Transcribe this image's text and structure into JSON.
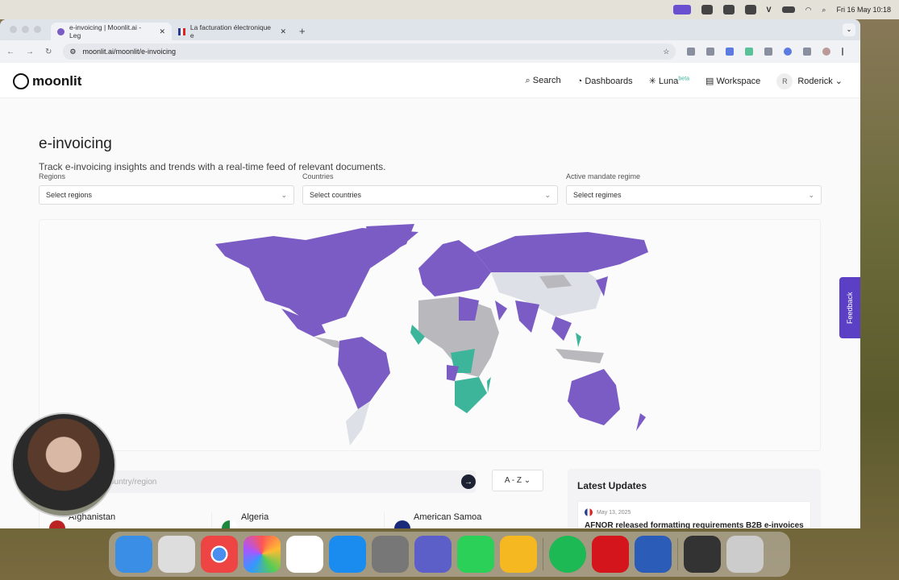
{
  "menubar": {
    "datetime": "Fri 16 May  10:18",
    "icons": [
      "apple-icon",
      "screen-share-icon",
      "wifi-icon",
      "battery-icon",
      "search-icon",
      "control-center-icon"
    ]
  },
  "browser": {
    "tabs": [
      {
        "label": "e-invoicing | Moonlit.ai - Leg"
      },
      {
        "label": "La facturation électronique e"
      }
    ],
    "url": "moonlit.ai/moonlit/e-invoicing"
  },
  "nav": {
    "logo": "moonlit",
    "search": "Search",
    "dashboards": "Dashboards",
    "luna": "Luna",
    "luna_badge": "beta",
    "workspace": "Workspace",
    "user_initial": "R",
    "user": "Roderick"
  },
  "page": {
    "title": "e-invoicing",
    "subtitle": "Track e-invoicing insights and trends with a real-time feed of relevant documents.",
    "filters": [
      {
        "label": "Regions",
        "placeholder": "Select regions"
      },
      {
        "label": "Countries",
        "placeholder": "Select countries"
      },
      {
        "label": "Active mandate regime",
        "placeholder": "Select regimes"
      }
    ],
    "search_placeholder": "ountry/region",
    "sort": "A - Z",
    "countries": [
      {
        "name": "Afghanistan"
      },
      {
        "name": "Algeria"
      },
      {
        "name": "American Samoa"
      }
    ],
    "feedback": "Feedback",
    "updates": {
      "title": "Latest Updates",
      "items": [
        {
          "date": "May 13, 2025",
          "title": "AFNOR released formatting requirements B2B e-invoices"
        }
      ]
    }
  },
  "colors": {
    "active": "#7b5cc4",
    "planned": "#3db59a",
    "none": "#b9b9bd",
    "nodata": "#dde0e6"
  }
}
